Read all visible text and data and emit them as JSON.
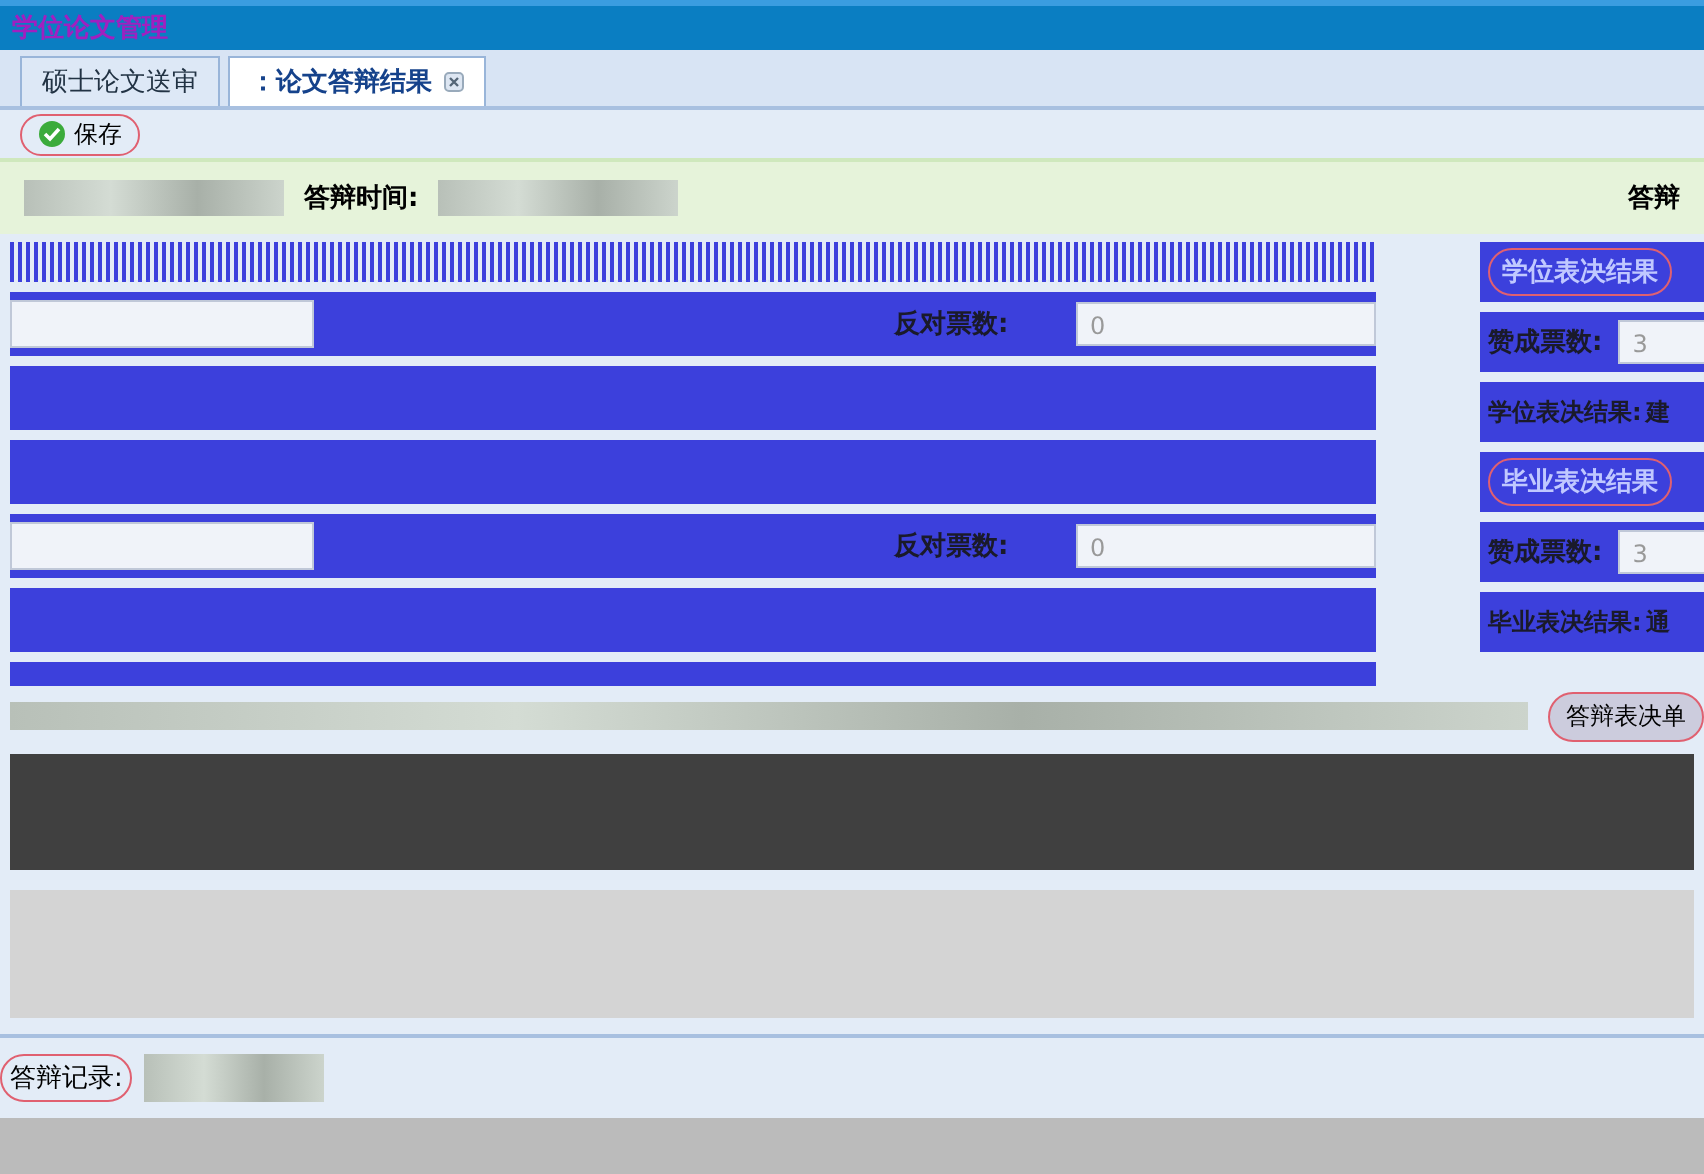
{
  "app_title": "学位论文管理",
  "tabs": [
    {
      "label": "硕士论文送审",
      "selected": false,
      "closable": false
    },
    {
      "label": "：论文答辩结果",
      "selected": true,
      "closable": true
    }
  ],
  "toolbar": [
    {
      "label": "保存"
    }
  ],
  "info": {
    "time_label": "答辩时间:",
    "cut_label": "答辩"
  },
  "vote_rows": [
    {
      "label": "反对票数:",
      "value": "0"
    },
    {
      "label": "反对票数:",
      "value": "0"
    }
  ],
  "decisions": [
    {
      "title": "学位表决结果",
      "votes_label": "赞成票数:",
      "votes_value": "3",
      "result_label": "学位表决结果:",
      "result_value": "建"
    },
    {
      "title": "毕业表决结果",
      "votes_label": "赞成票数:",
      "votes_value": "3",
      "result_label": "毕业表决结果:",
      "result_value": "通"
    }
  ],
  "action_button": "答辩表决单",
  "record_label": "答辩记录:"
}
